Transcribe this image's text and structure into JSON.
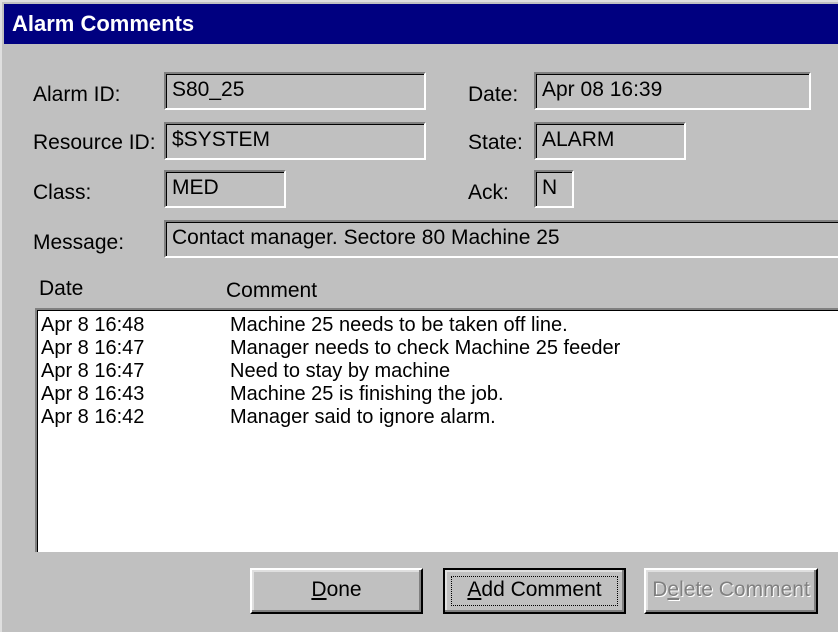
{
  "window": {
    "title": "Alarm Comments"
  },
  "fields": {
    "alarm_id": {
      "label": "Alarm ID:",
      "value": "S80_25"
    },
    "date": {
      "label": "Date:",
      "value": "Apr 08 16:39"
    },
    "resource_id": {
      "label": "Resource ID:",
      "value": "$SYSTEM"
    },
    "state": {
      "label": "State:",
      "value": "ALARM"
    },
    "class": {
      "label": "Class:",
      "value": "MED"
    },
    "ack": {
      "label": "Ack:",
      "value": "N"
    },
    "message": {
      "label": "Message:",
      "value": "Contact manager. Sectore 80 Machine 25"
    }
  },
  "comments": {
    "columns": [
      "Date",
      "Comment"
    ],
    "rows": [
      {
        "date": "Apr 8 16:48",
        "comment": "Machine 25 needs to be taken off line."
      },
      {
        "date": "Apr 8 16:47",
        "comment": "Manager needs to check Machine 25 feeder"
      },
      {
        "date": "Apr 8 16:47",
        "comment": "Need to stay by machine"
      },
      {
        "date": "Apr 8 16:43",
        "comment": "Machine 25 is finishing the job."
      },
      {
        "date": "Apr 8 16:42",
        "comment": "Manager said to ignore alarm."
      }
    ]
  },
  "buttons": {
    "done": {
      "mnemonic": "D",
      "rest": "one"
    },
    "add_comment": {
      "mnemonic": "A",
      "rest": "dd Comment"
    },
    "delete_comment": {
      "pre": "D",
      "mnemonic": "e",
      "rest": "lete Comment",
      "enabled": false
    }
  },
  "colors": {
    "title_bar": "#000080",
    "face": "#c0c0c0",
    "list_bg": "#ffffff",
    "disabled_text": "#808080"
  }
}
